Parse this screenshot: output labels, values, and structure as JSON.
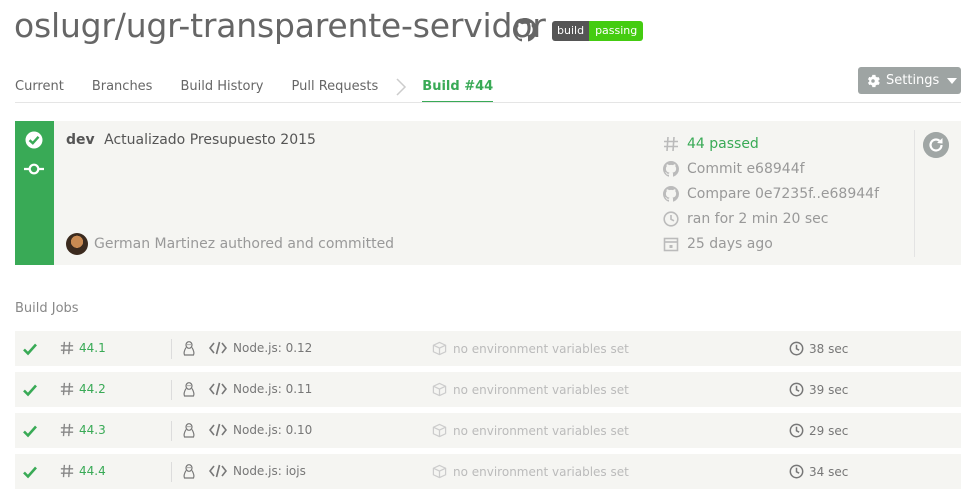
{
  "repo": {
    "title": "oslugr/ugr-transparente-servidor",
    "badge_left": "build",
    "badge_right": "passing",
    "badge_color": "#44cc11"
  },
  "tabs": [
    {
      "label": "Current"
    },
    {
      "label": "Branches"
    },
    {
      "label": "Build History"
    },
    {
      "label": "Pull Requests"
    },
    {
      "label": "Build #44"
    }
  ],
  "settings": {
    "label": "Settings",
    "icon": "gear-icon"
  },
  "build": {
    "status_color": "#39aa56",
    "branch": "dev",
    "message": "Actualizado Presupuesto 2015",
    "author_text": "German Martinez authored and committed",
    "number_text": "44 passed",
    "commit_text": "Commit e68944f",
    "compare_text": "Compare 0e7235f..e68944f",
    "duration_text": "ran for 2 min 20 sec",
    "finished_text": "25 days ago"
  },
  "jobs_title": "Build Jobs",
  "jobs": [
    {
      "number": "44.1",
      "lang": "Node.js: 0.12",
      "env": "no environment variables set",
      "duration": "38 sec"
    },
    {
      "number": "44.2",
      "lang": "Node.js: 0.11",
      "env": "no environment variables set",
      "duration": "39 sec"
    },
    {
      "number": "44.3",
      "lang": "Node.js: 0.10",
      "env": "no environment variables set",
      "duration": "29 sec"
    },
    {
      "number": "44.4",
      "lang": "Node.js: iojs",
      "env": "no environment variables set",
      "duration": "34 sec"
    }
  ]
}
